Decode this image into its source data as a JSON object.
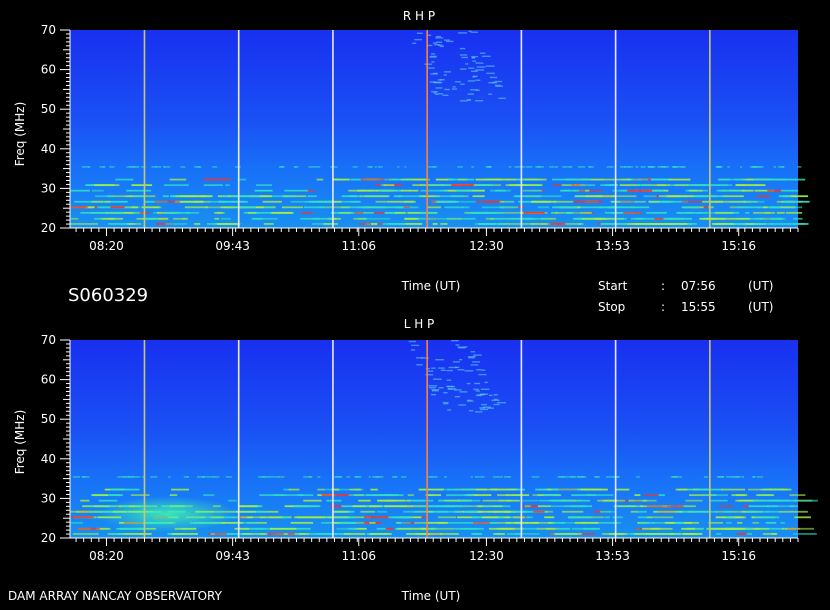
{
  "chart_data": [
    {
      "type": "heatmap",
      "title": "R H P",
      "ylabel": "Freq (MHz)",
      "xlabel": "Time (UT)",
      "ylim": [
        20,
        70
      ],
      "yticks": [
        20,
        30,
        40,
        50,
        60,
        70
      ],
      "xticks": [
        "08:20",
        "09:43",
        "11:06",
        "12:30",
        "13:53",
        "15:16"
      ],
      "markers": [
        {
          "time": "08:45",
          "color": "#c8c870"
        },
        {
          "time": "09:47",
          "color": "#e8e8ff"
        },
        {
          "time": "10:49",
          "color": "#e8e8ff"
        },
        {
          "time": "11:51",
          "color": "#ff8040"
        },
        {
          "time": "12:53",
          "color": "#e8e8ff"
        },
        {
          "time": "13:55",
          "color": "#e8e8ff"
        },
        {
          "time": "14:57",
          "color": "#c8c870"
        }
      ]
    },
    {
      "type": "heatmap",
      "title": "L H P",
      "ylabel": "Freq (MHz)",
      "xlabel": "Time (UT)",
      "ylim": [
        20,
        70
      ],
      "yticks": [
        20,
        30,
        40,
        50,
        60,
        70
      ],
      "xticks": [
        "08:20",
        "09:43",
        "11:06",
        "12:30",
        "13:53",
        "15:16"
      ],
      "markers": [
        {
          "time": "08:45",
          "color": "#c8c870"
        },
        {
          "time": "09:47",
          "color": "#e8e8ff"
        },
        {
          "time": "10:49",
          "color": "#e8e8ff"
        },
        {
          "time": "11:51",
          "color": "#ff8040"
        },
        {
          "time": "12:53",
          "color": "#e8e8ff"
        },
        {
          "time": "13:55",
          "color": "#e8e8ff"
        },
        {
          "time": "14:57",
          "color": "#c8c870"
        }
      ]
    }
  ],
  "session": {
    "id": "S060329",
    "start_label": "Start",
    "start_sep": ":",
    "start_time": "07:56",
    "stop_label": "Stop",
    "stop_sep": ":",
    "stop_time": "15:55",
    "ut_unit": "(UT)"
  },
  "footer": {
    "credit": "DAM ARRAY   NANCAY OBSERVATORY",
    "time_label": "Time (UT)"
  },
  "colors": {
    "background_low": "#1020e0",
    "background_mid": "#1868f8",
    "band_cyan": "#30e0c0",
    "band_green": "#a0f040",
    "band_red": "#ff3020"
  }
}
